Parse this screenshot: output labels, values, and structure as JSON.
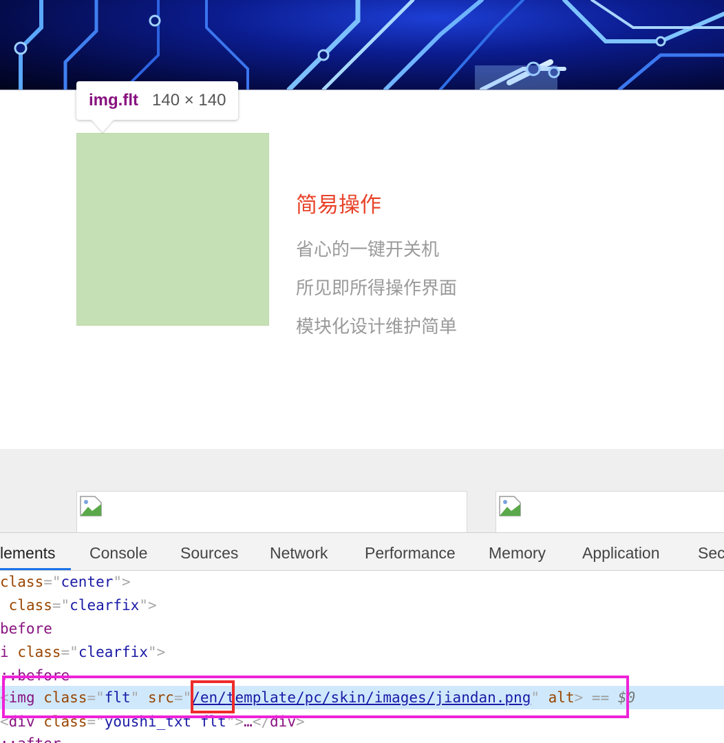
{
  "tooltip": {
    "tag": "img.flt",
    "dims": "140 × 140"
  },
  "feature": {
    "title": "简易操作",
    "lines": [
      "省心的一键开关机",
      "所见即所得操作界面",
      "模块化设计维护简单"
    ]
  },
  "devtools": {
    "tabs": [
      {
        "label": "lements"
      },
      {
        "label": "Console"
      },
      {
        "label": "Sources"
      },
      {
        "label": "Network"
      },
      {
        "label": "Performance"
      },
      {
        "label": "Memory"
      },
      {
        "label": "Application"
      },
      {
        "label": "Sec"
      }
    ],
    "lines": {
      "l1_attr": "class",
      "l1_val": "center",
      "l2_attr": "class",
      "l2_val": "clearfix",
      "l3_pseudo": "before",
      "l4_tag": "i",
      "l4_attr": "class",
      "l4_val": "clearfix",
      "l5_pseudo": "::before",
      "l6_tag": "img",
      "l6_attr1": "class",
      "l6_val1": "flt",
      "l6_attr2": "src",
      "l6_link_prefix": "/en/",
      "l6_link_rest": "template/pc/skin/images/jiandan.png",
      "l6_attr3": "alt",
      "l6_eq": "==",
      "l6_ref": "$0",
      "l7_tag": "div",
      "l7_attr": "class",
      "l7_val": "youshi_txt flt",
      "l7_ellipsis": "…",
      "l7_close": "div",
      "l8_pseudo": "::after"
    }
  },
  "colors": {
    "title_red": "#e8442a",
    "highlight_green": "#c6e0b6",
    "annotation_magenta": "#ef22d8",
    "annotation_red": "#ee2b2b",
    "selected_row": "#cfe8fc"
  }
}
